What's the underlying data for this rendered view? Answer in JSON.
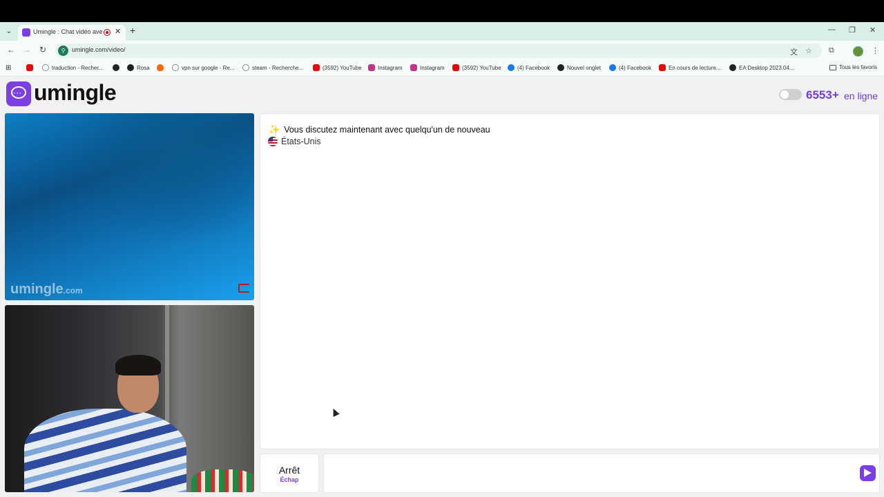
{
  "browser": {
    "tab_title": "Umingle : Chat vidéo avec d",
    "url": "umingle.com/video/",
    "bookmarks": [
      {
        "label": "",
        "icon": "youtube-icon"
      },
      {
        "label": "traduction - Recher...",
        "icon": "google-icon"
      },
      {
        "label": "",
        "icon": "chrome-icon"
      },
      {
        "label": "Rosa",
        "icon": "chrome-icon"
      },
      {
        "label": "",
        "icon": "fire-icon"
      },
      {
        "label": "vpn sur google - Re...",
        "icon": "google-icon"
      },
      {
        "label": "steam - Recherche...",
        "icon": "google-icon"
      },
      {
        "label": "(3592) YouTube",
        "icon": "youtube-icon"
      },
      {
        "label": "Instagram",
        "icon": "instagram-icon"
      },
      {
        "label": "Instagram",
        "icon": "instagram-icon"
      },
      {
        "label": "(3592) YouTube",
        "icon": "youtube-icon"
      },
      {
        "label": "(4) Facebook",
        "icon": "facebook-icon"
      },
      {
        "label": "Nouvel onglet",
        "icon": "chrome-icon"
      },
      {
        "label": "(4) Facebook",
        "icon": "facebook-icon"
      },
      {
        "label": "En cours de lecture...",
        "icon": "youtube-icon"
      },
      {
        "label": "EA Desktop 2023.04...",
        "icon": "chrome-icon"
      }
    ],
    "all_bookmarks_label": "Tous les favoris"
  },
  "header": {
    "brand": "umingle",
    "online_count": "6553+",
    "online_label": "en ligne",
    "accent_color": "#7b3fe4"
  },
  "video": {
    "watermark_main": "umingle",
    "watermark_suffix": ".com"
  },
  "chat": {
    "system_message": "Vous discutez maintenant avec quelqu'un de nouveau",
    "country": "États-Unis"
  },
  "controls": {
    "stop_label": "Arrêt",
    "stop_hint": "Échap",
    "message_placeholder": ""
  }
}
